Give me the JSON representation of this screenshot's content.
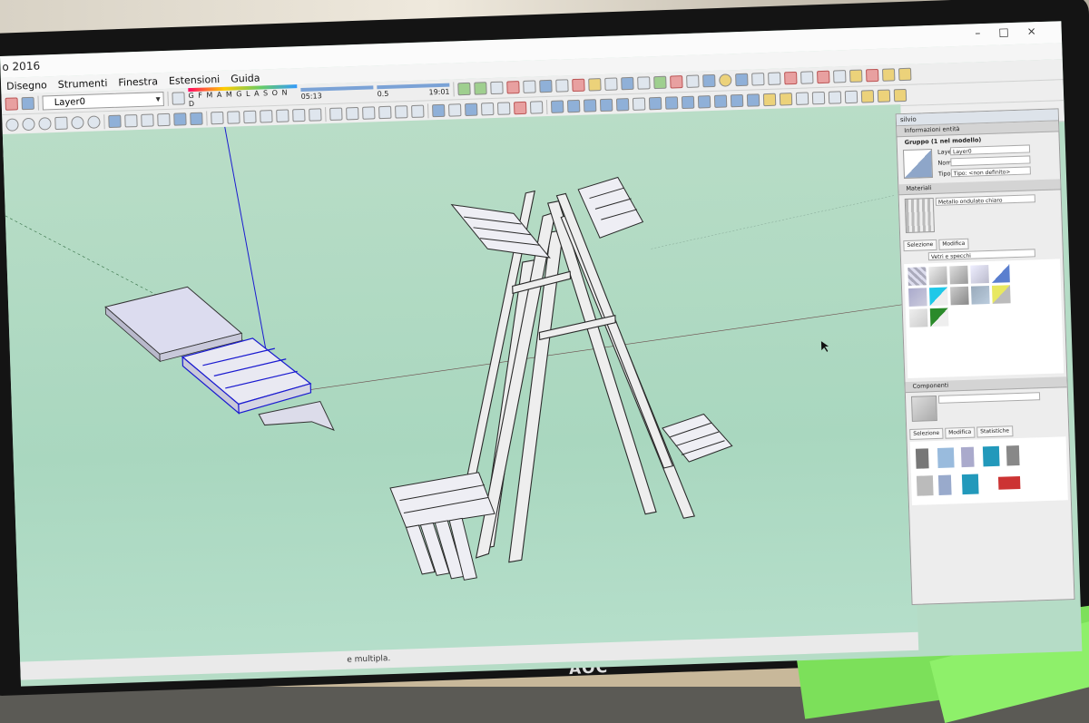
{
  "app": {
    "title": "o 2016"
  },
  "menu": [
    "Disegno",
    "Strumenti",
    "Finestra",
    "Estensioni",
    "Guida"
  ],
  "toolbar": {
    "layer": "Layer0",
    "months": "G F M A M G L A S O N D",
    "time_start": "05:13",
    "time_mid": "0.5",
    "time_end": "19:01"
  },
  "panel": {
    "header": "silvio",
    "entity_info": "Informazioni entità",
    "group": "Gruppo (1 nel modello)",
    "layer_label": "Layer:",
    "layer_value": "Layer0",
    "name_label": "Nome:",
    "type_label": "Tipo:",
    "type_value": "Tipo: <non definito>",
    "materials": "Materiali",
    "material_name": "Metallo ondulato chiaro",
    "tab_select": "Selezione",
    "tab_edit": "Modifica",
    "library": "Vetri e specchi",
    "components": "Componenti",
    "ctab_select": "Selezione",
    "ctab_edit": "Modifica",
    "ctab_stats": "Statistiche"
  },
  "status": {
    "text": "e multipla."
  },
  "monitor": {
    "brand": "AOC"
  },
  "colors": {
    "viewport": "#b5dcc6",
    "selection": "#1a1ad0",
    "model_face": "#eeeeee",
    "model_edge": "#2a2a2a"
  }
}
